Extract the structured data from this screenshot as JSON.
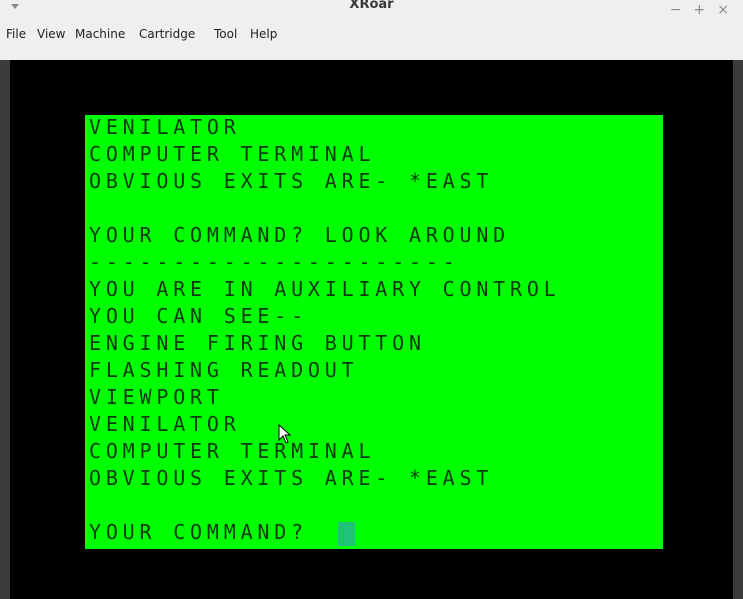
{
  "window": {
    "title": "XRoar",
    "controls": {
      "minimize": "−",
      "maximize": "+",
      "close": "×"
    }
  },
  "menubar": {
    "items": [
      "File",
      "View",
      "Machine",
      "Cartridge",
      "Tool",
      "Help"
    ]
  },
  "terminal": {
    "background": "#00ff00",
    "text_color": "#0a3a0a",
    "cursor_color": "#1fc27a",
    "lines": [
      "VENILATOR",
      "COMPUTER TERMINAL",
      "OBVIOUS EXITS ARE- *EAST",
      "",
      "YOUR COMMAND? LOOK AROUND",
      "----------------------",
      "YOU ARE IN AUXILIARY CONTROL",
      "YOU CAN SEE--",
      "ENGINE FIRING BUTTON",
      "FLASHING READOUT",
      "VIEWPORT",
      "VENILATOR",
      "COMPUTER TERMINAL",
      "OBVIOUS EXITS ARE- *EAST",
      "",
      "YOUR COMMAND? "
    ]
  }
}
